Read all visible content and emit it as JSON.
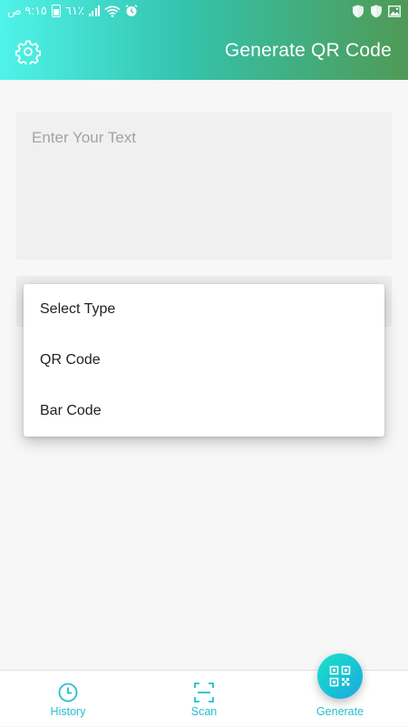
{
  "status_bar": {
    "time_text": "٩:١٥ ص",
    "battery_text": "٦١٪",
    "icons": [
      "battery-icon",
      "cell-signal-icon",
      "wifi-icon",
      "alarm-icon",
      "shield-icon",
      "shield-icon",
      "image-icon"
    ]
  },
  "header": {
    "title": "Generate QR Code",
    "settings_icon": "gear-icon"
  },
  "input": {
    "placeholder": "Enter Your Text"
  },
  "dropdown": {
    "items": [
      "Select Type",
      "QR Code",
      "Bar Code"
    ]
  },
  "bottom_nav": {
    "items": [
      {
        "label": "History",
        "icon": "clock-icon"
      },
      {
        "label": "Scan",
        "icon": "scan-frame-icon"
      },
      {
        "label": "Generate",
        "icon": "qr-code-icon"
      }
    ]
  },
  "colors": {
    "header_gradient_start": "#4ff3ea",
    "header_gradient_end": "#4f9a55",
    "accent": "#23bfd1"
  }
}
